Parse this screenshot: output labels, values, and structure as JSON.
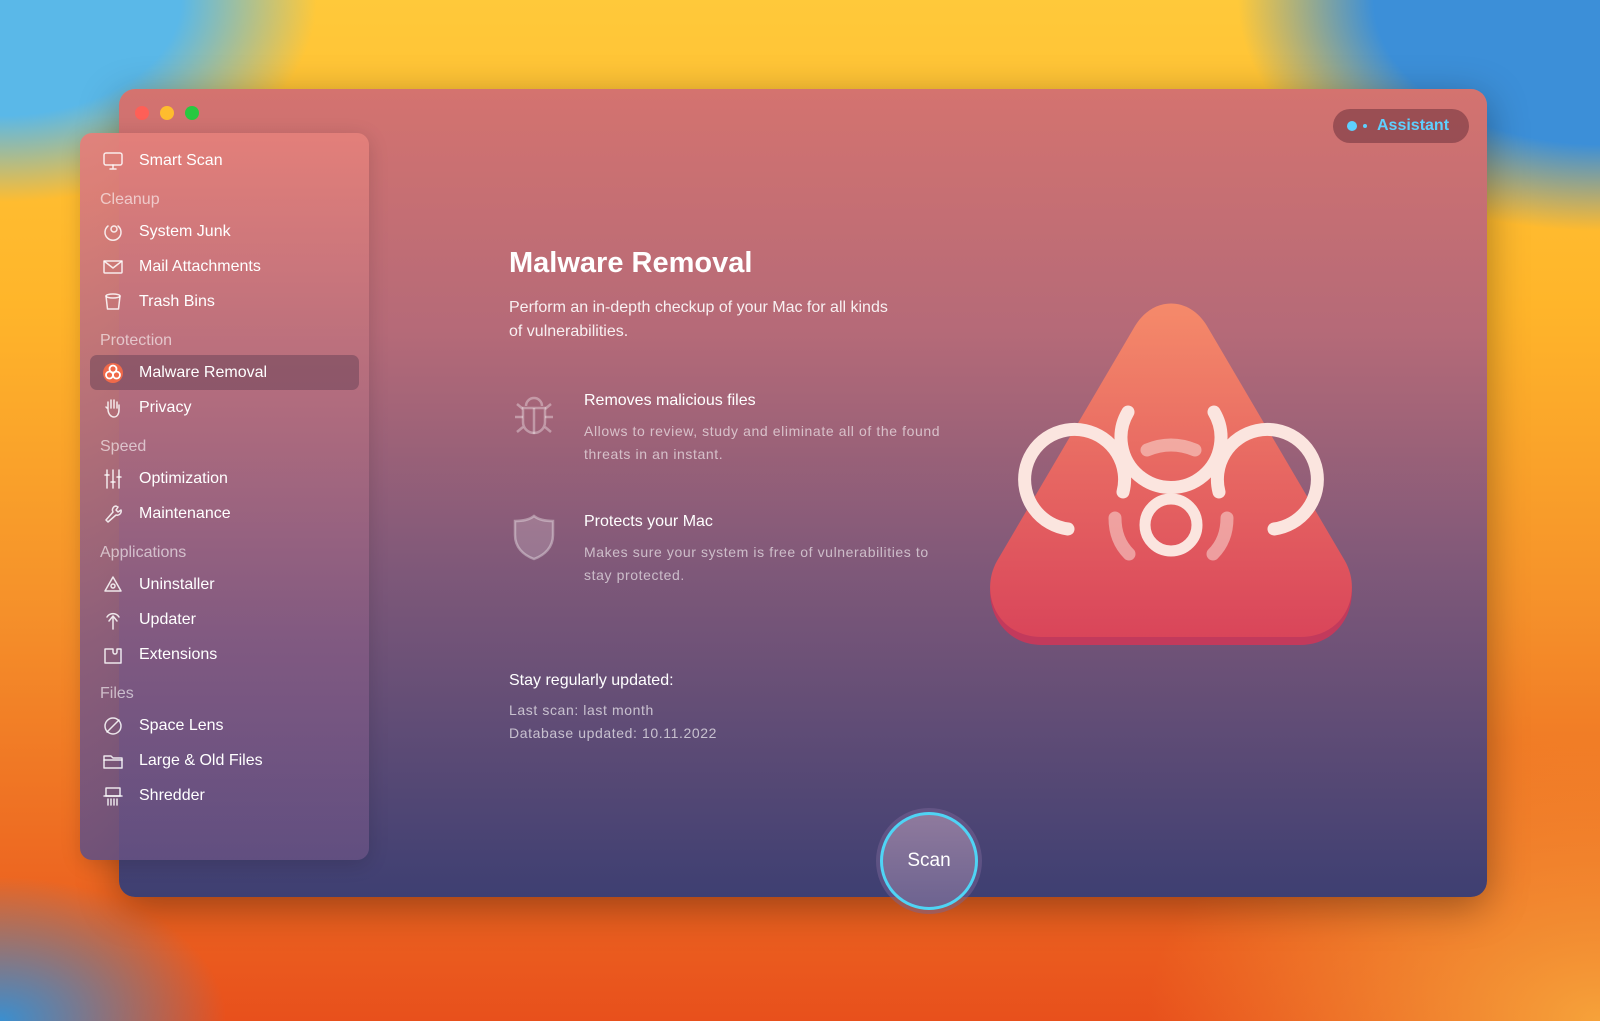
{
  "window": {
    "lights": {
      "close": "#fe5f57",
      "minimize": "#febc2e",
      "zoom": "#28c840"
    }
  },
  "assistant": {
    "label": "Assistant",
    "color": "#5ed0ff"
  },
  "sidebar": {
    "smart_scan": {
      "label": "Smart Scan",
      "icon": "monitor-icon"
    },
    "sections": [
      {
        "title": "Cleanup",
        "items": [
          {
            "label": "System Junk",
            "icon": "junk-icon"
          },
          {
            "label": "Mail Attachments",
            "icon": "mail-icon"
          },
          {
            "label": "Trash Bins",
            "icon": "trash-icon"
          }
        ]
      },
      {
        "title": "Protection",
        "items": [
          {
            "label": "Malware Removal",
            "icon": "biohazard-icon",
            "active": true
          },
          {
            "label": "Privacy",
            "icon": "hand-icon"
          }
        ]
      },
      {
        "title": "Speed",
        "items": [
          {
            "label": "Optimization",
            "icon": "sliders-icon"
          },
          {
            "label": "Maintenance",
            "icon": "wrench-icon"
          }
        ]
      },
      {
        "title": "Applications",
        "items": [
          {
            "label": "Uninstaller",
            "icon": "uninstaller-icon"
          },
          {
            "label": "Updater",
            "icon": "updater-icon"
          },
          {
            "label": "Extensions",
            "icon": "extensions-icon"
          }
        ]
      },
      {
        "title": "Files",
        "items": [
          {
            "label": "Space Lens",
            "icon": "lens-icon"
          },
          {
            "label": "Large & Old Files",
            "icon": "folder-icon"
          },
          {
            "label": "Shredder",
            "icon": "shredder-icon"
          }
        ]
      }
    ]
  },
  "main": {
    "title": "Malware Removal",
    "subtitle": "Perform an in-depth checkup of your Mac for all kinds of vulnerabilities.",
    "features": [
      {
        "title": "Removes malicious files",
        "desc": "Allows to review, study and eliminate all of the found threats in an instant.",
        "icon": "bug-icon"
      },
      {
        "title": "Protects your Mac",
        "desc": "Makes sure your system is free of vulnerabilities to stay protected.",
        "icon": "shield-icon"
      }
    ],
    "update_title": "Stay regularly updated:",
    "last_scan": "Last scan: last month",
    "database": "Database updated: 10.11.2022",
    "scan_label": "Scan"
  }
}
